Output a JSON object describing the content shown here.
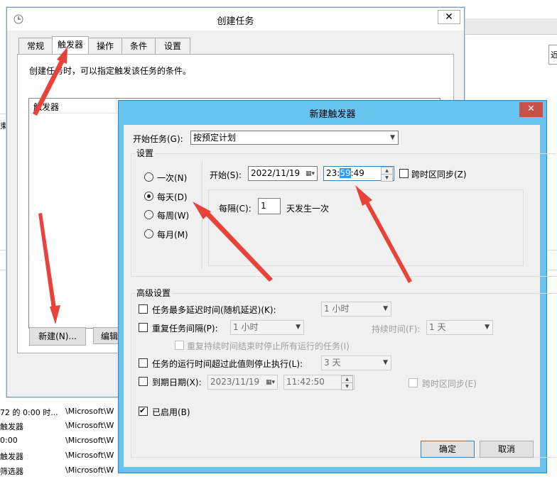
{
  "background": {
    "right_text": "近",
    "left_fragments": [
      "束"
    ],
    "rows": [
      {
        "left": "",
        "path": ""
      },
      {
        "left": "72 的 0:00 时...",
        "path": "\\Microsoft\\W"
      },
      {
        "left": "触发器",
        "path": "\\Microsoft\\W"
      },
      {
        "left": "0:00",
        "path": "\\Microsoft\\W"
      },
      {
        "left": "触发器",
        "path": "\\Microsoft\\W"
      },
      {
        "left": "筛选器",
        "path": "\\Microsoft\\W"
      }
    ]
  },
  "create_task": {
    "title": "创建任务",
    "close": "✕",
    "tabs": [
      "常规",
      "触发器",
      "操作",
      "条件",
      "设置"
    ],
    "active_tab": "触发器",
    "description": "创建任务时，可以指定触发该任务的条件。",
    "list_header": "触发器",
    "new_button": "新建(N)...",
    "edit_button": "编辑"
  },
  "new_trigger": {
    "title": "新建触发器",
    "close": "✕",
    "begin_task_label": "开始任务(G):",
    "begin_task_value": "按预定计划",
    "settings_label": "设置",
    "schedule_options": [
      "一次(N)",
      "每天(D)",
      "每周(W)",
      "每月(M)"
    ],
    "selected_option": "每天(D)",
    "start_label": "开始(S):",
    "start_date": "2022/11/19",
    "start_time_prefix": "23:",
    "start_time_selected": "59",
    "start_time_suffix": ":49",
    "sync_tz_label": "跨时区同步(Z)",
    "every_label": "每隔(C):",
    "every_value": "1",
    "every_suffix": "天发生一次",
    "advanced_label": "高级设置",
    "delay_label": "任务最多延迟时间(随机延迟)(K):",
    "delay_value": "1 小时",
    "repeat_label": "重复任务间隔(P):",
    "repeat_value": "1 小时",
    "duration_label": "持续时间(F):",
    "duration_value": "1 天",
    "stop_all_label": "重复持续时间结束时停止所有运行的任务(I)",
    "stop_long_label": "任务的运行时间超过此值则停止执行(L):",
    "stop_long_value": "3 天",
    "expire_label": "到期日期(X):",
    "expire_date": "2023/11/19",
    "expire_time": "11:42:50",
    "expire_sync_label": "跨时区同步(E)",
    "enabled_label": "已启用(B)",
    "enabled_checked": true,
    "ok_button": "确定",
    "cancel_button": "取消"
  },
  "colors": {
    "dialog_frame": "#67c4ef",
    "close_red": "#c7504a",
    "arrow_red": "#e8433b",
    "selection": "#3399ff"
  }
}
